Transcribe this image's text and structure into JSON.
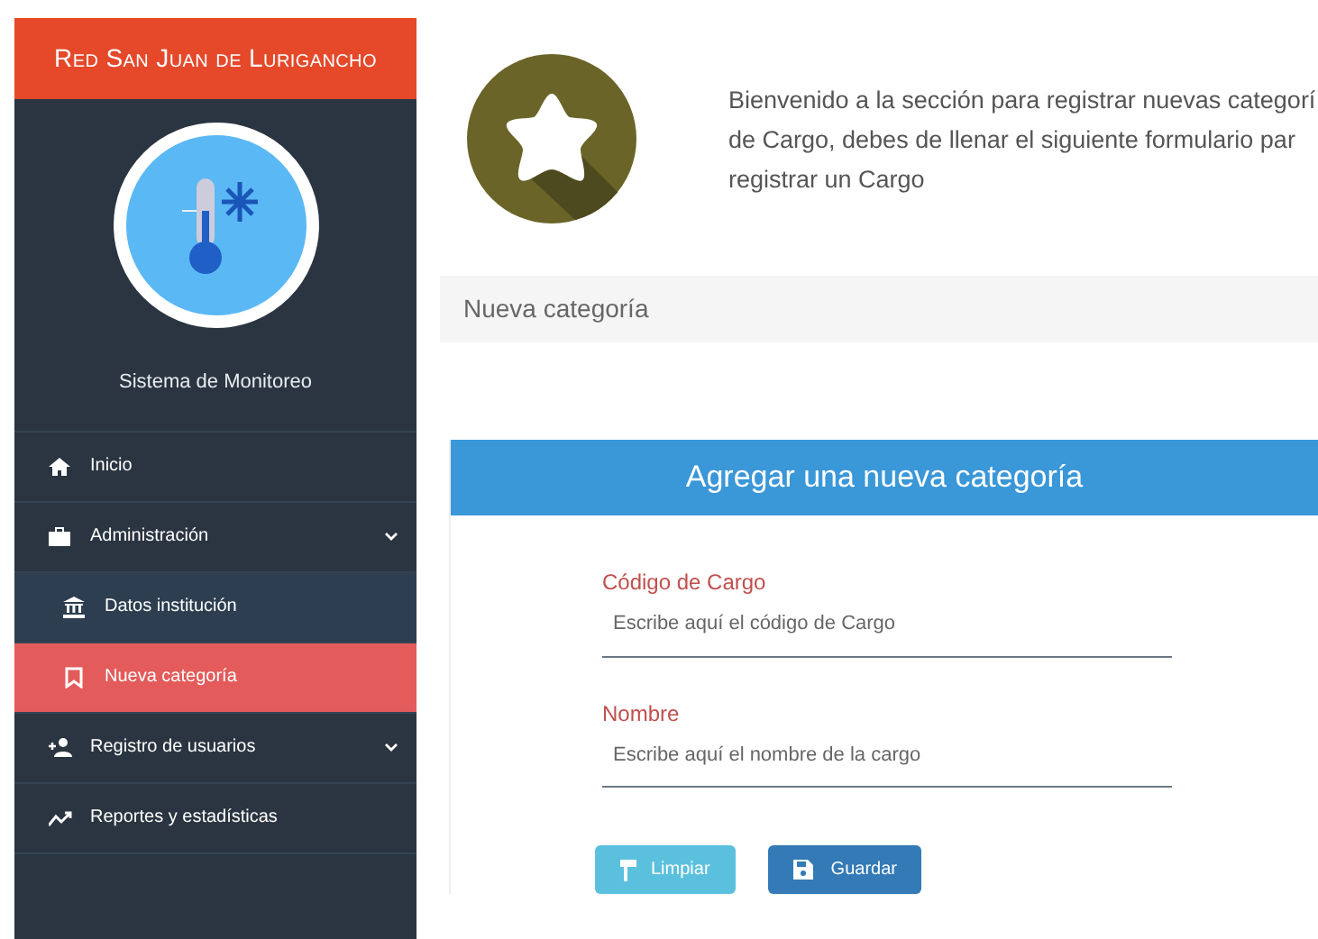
{
  "sidebar": {
    "brand": "Red San Juan de Lurigancho",
    "profile_caption": "Sistema de Monitoreo",
    "items": [
      {
        "label": "Inicio",
        "kind": "item",
        "submenu": false,
        "selected": false
      },
      {
        "label": "Administración",
        "kind": "item",
        "submenu": true,
        "selected": false
      },
      {
        "label": "Datos institución",
        "kind": "subitem",
        "submenu": false,
        "selected": false
      },
      {
        "label": "Nueva categoría",
        "kind": "subitem",
        "submenu": false,
        "selected": true
      },
      {
        "label": "Registro de usuarios",
        "kind": "item",
        "submenu": true,
        "selected": false
      },
      {
        "label": "Reportes y estadísticas",
        "kind": "item",
        "submenu": false,
        "selected": false
      }
    ]
  },
  "intro": {
    "lines": [
      "Bienvenido a la sección para registrar nuevas categorí",
      "de Cargo, debes de llenar el siguiente formulario par",
      "registrar un Cargo"
    ]
  },
  "breadcrumb": "Nueva categoría",
  "form": {
    "title": "Agregar una nueva categoría",
    "fields": [
      {
        "label": "Código de Cargo",
        "placeholder": "Escribe aquí el código de Cargo"
      },
      {
        "label": "Nombre",
        "placeholder": "Escribe aquí el nombre de la cargo"
      }
    ],
    "buttons": [
      {
        "label": "Limpiar",
        "kind": "clear"
      },
      {
        "label": "Guardar",
        "kind": "save"
      }
    ]
  }
}
